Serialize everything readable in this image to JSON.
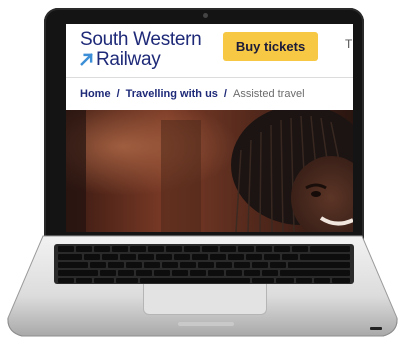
{
  "logo": {
    "line1": "South Western",
    "line2": "Railway"
  },
  "header": {
    "buy_label": "Buy tickets",
    "overflow_glyph": "T"
  },
  "breadcrumb": {
    "items": [
      "Home",
      "Travelling with us"
    ],
    "separator": "/",
    "current": "Assisted travel"
  },
  "colors": {
    "brand": "#1e2a78",
    "cta": "#f6c843",
    "arrow": "#3c8fd6"
  }
}
